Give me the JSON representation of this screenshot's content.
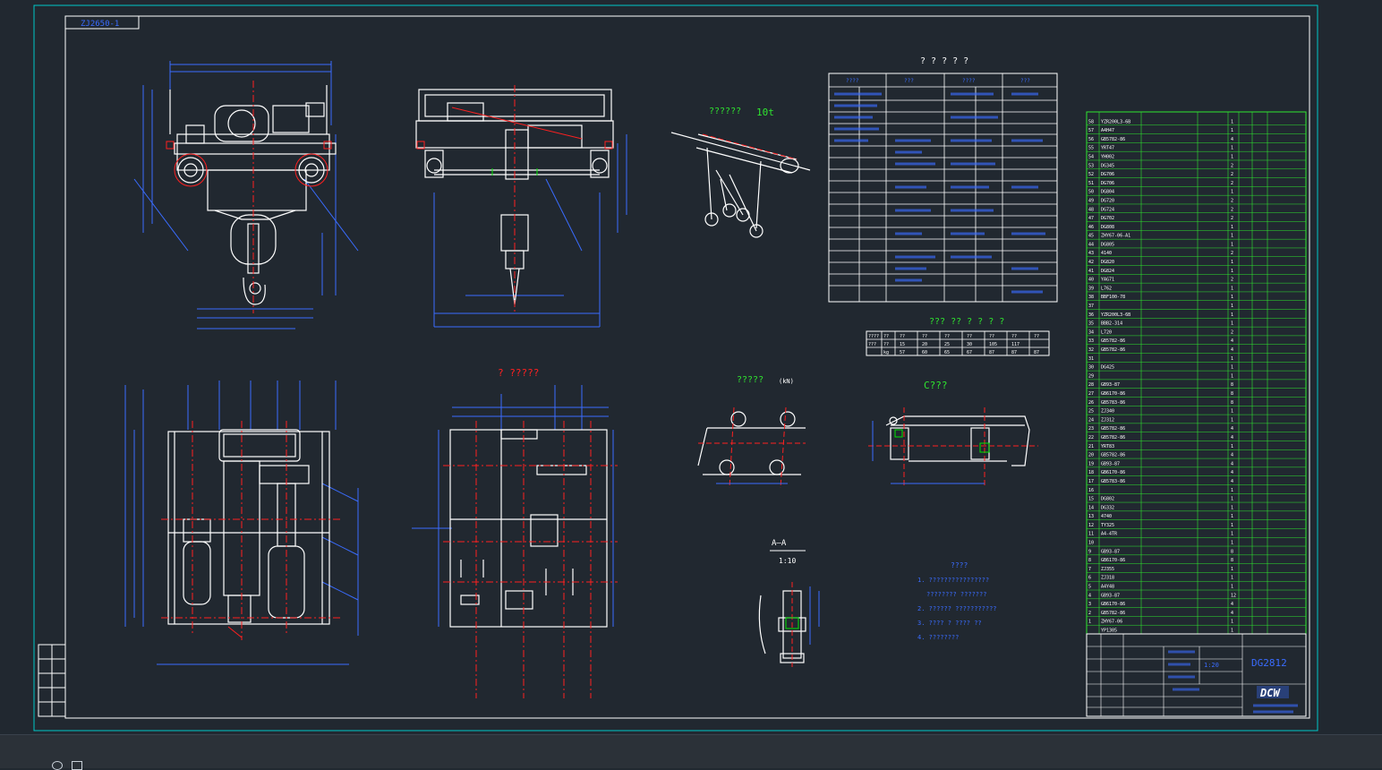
{
  "drawing": {
    "sheet_tag": "ZJ2650-1",
    "drawing_number": "DG2812",
    "logo_text": "DCW",
    "scale_labels": [
      "1:20",
      "1:10"
    ],
    "view_titles": {
      "detail_top": "??????",
      "capacity": "10t",
      "detail_mid": "?????",
      "detail_mid_unit": "(kN)",
      "section_c": "C???",
      "section_aa": "A—A",
      "view_b": "? ?????",
      "table_title": "???  ?? ? ? ? ?"
    },
    "notes": [
      "1. ????????????????",
      "????????  ???????",
      "2. ??????  ???????????",
      "3. ????  ? ????  ??",
      "4. ????????"
    ],
    "parts_rows": [
      {
        "no": "58",
        "code": "YZR200L3-6B",
        "qty": "1"
      },
      {
        "no": "57",
        "code": "A4H47",
        "qty": "1"
      },
      {
        "no": "56",
        "code": "GB5782-86",
        "qty": "4"
      },
      {
        "no": "55",
        "code": "YRT47",
        "qty": "1"
      },
      {
        "no": "54",
        "code": "YH002",
        "qty": "1"
      },
      {
        "no": "53",
        "code": "DG345",
        "qty": "2"
      },
      {
        "no": "52",
        "code": "DG706",
        "qty": "2"
      },
      {
        "no": "51",
        "code": "DG706",
        "qty": "2"
      },
      {
        "no": "50",
        "code": "DG804",
        "qty": "1"
      },
      {
        "no": "49",
        "code": "DG720",
        "qty": "2"
      },
      {
        "no": "48",
        "code": "DG724",
        "qty": "2"
      },
      {
        "no": "47",
        "code": "DG702",
        "qty": "2"
      },
      {
        "no": "46",
        "code": "DG808",
        "qty": "1"
      },
      {
        "no": "45",
        "code": "ZHY67-06-A1",
        "qty": "1"
      },
      {
        "no": "44",
        "code": "DG805",
        "qty": "1"
      },
      {
        "no": "43",
        "code": "4140",
        "qty": "2"
      },
      {
        "no": "42",
        "code": "DG820",
        "qty": "1"
      },
      {
        "no": "41",
        "code": "DG824",
        "qty": "1"
      },
      {
        "no": "40",
        "code": "YAG71",
        "qty": "2"
      },
      {
        "no": "39",
        "code": "L762",
        "qty": "1"
      },
      {
        "no": "38",
        "code": "BBF100-78",
        "qty": "1"
      },
      {
        "no": "37",
        "code": "",
        "qty": "1"
      },
      {
        "no": "36",
        "code": "YZR200L3-6B",
        "qty": "1"
      },
      {
        "no": "35",
        "code": "BBB2-314",
        "qty": "1"
      },
      {
        "no": "34",
        "code": "L720",
        "qty": "2"
      },
      {
        "no": "33",
        "code": "GB5782-86",
        "qty": "4"
      },
      {
        "no": "32",
        "code": "GB5782-86",
        "qty": "4"
      },
      {
        "no": "31",
        "code": "",
        "qty": "1"
      },
      {
        "no": "30",
        "code": "DG425",
        "qty": "1"
      },
      {
        "no": "29",
        "code": "",
        "qty": "1"
      },
      {
        "no": "28",
        "code": "GB93-87",
        "qty": "8"
      },
      {
        "no": "27",
        "code": "GB6170-86",
        "qty": "8"
      },
      {
        "no": "26",
        "code": "GB5783-86",
        "qty": "8"
      },
      {
        "no": "25",
        "code": "ZJ340",
        "qty": "1"
      },
      {
        "no": "24",
        "code": "ZJ312",
        "qty": "1"
      },
      {
        "no": "23",
        "code": "GB5782-86",
        "qty": "4"
      },
      {
        "no": "22",
        "code": "GB5782-86",
        "qty": "4"
      },
      {
        "no": "21",
        "code": "YRT83",
        "qty": "1"
      },
      {
        "no": "20",
        "code": "GB5782-86",
        "qty": "4"
      },
      {
        "no": "19",
        "code": "GB93-87",
        "qty": "4"
      },
      {
        "no": "18",
        "code": "GB6170-86",
        "qty": "4"
      },
      {
        "no": "17",
        "code": "GB5783-86",
        "qty": "4"
      },
      {
        "no": "16",
        "code": "",
        "qty": "1"
      },
      {
        "no": "15",
        "code": "DG802",
        "qty": "1"
      },
      {
        "no": "14",
        "code": "DG332",
        "qty": "1"
      },
      {
        "no": "13",
        "code": "4740",
        "qty": "1"
      },
      {
        "no": "12",
        "code": "TY325",
        "qty": "1"
      },
      {
        "no": "11",
        "code": "A4-4TR",
        "qty": "1"
      },
      {
        "no": "10",
        "code": "",
        "qty": "1"
      },
      {
        "no": "9",
        "code": "GB93-87",
        "qty": "8"
      },
      {
        "no": "8",
        "code": "GB6170-86",
        "qty": "8"
      },
      {
        "no": "7",
        "code": "ZJ355",
        "qty": "1"
      },
      {
        "no": "6",
        "code": "ZJ318",
        "qty": "1"
      },
      {
        "no": "5",
        "code": "A4Y48",
        "qty": "1"
      },
      {
        "no": "4",
        "code": "GB93-87",
        "qty": "12"
      },
      {
        "no": "3",
        "code": "GB6170-86",
        "qty": "4"
      },
      {
        "no": "2",
        "code": "GB5782-86",
        "qty": "4"
      },
      {
        "no": "1",
        "code": "ZHY67-06",
        "qty": "1"
      },
      {
        "no": "",
        "code": "YP1305",
        "qty": "1"
      }
    ],
    "capacity_table": {
      "rows": [
        [
          "????",
          "??",
          "??",
          "??",
          "??",
          "??",
          "??",
          "??",
          "??"
        ],
        [
          "???",
          "??",
          "15",
          "20",
          "25",
          "30",
          "105",
          "117",
          ""
        ],
        [
          "",
          "kg",
          "57",
          "60",
          "65",
          "67",
          "87",
          "87",
          "87"
        ]
      ]
    }
  },
  "colors": {
    "background": "#212830",
    "frame": "#00c8c8",
    "geometry": "#ffffff",
    "dimension": "#3a6cff",
    "centerline": "#ff2020",
    "table_lines": "#2fe62f",
    "table_text": "#ffffff",
    "highlight": "#00e600"
  },
  "statusbar": {
    "icons": [
      "viewport-icon",
      "layout-icon"
    ]
  }
}
